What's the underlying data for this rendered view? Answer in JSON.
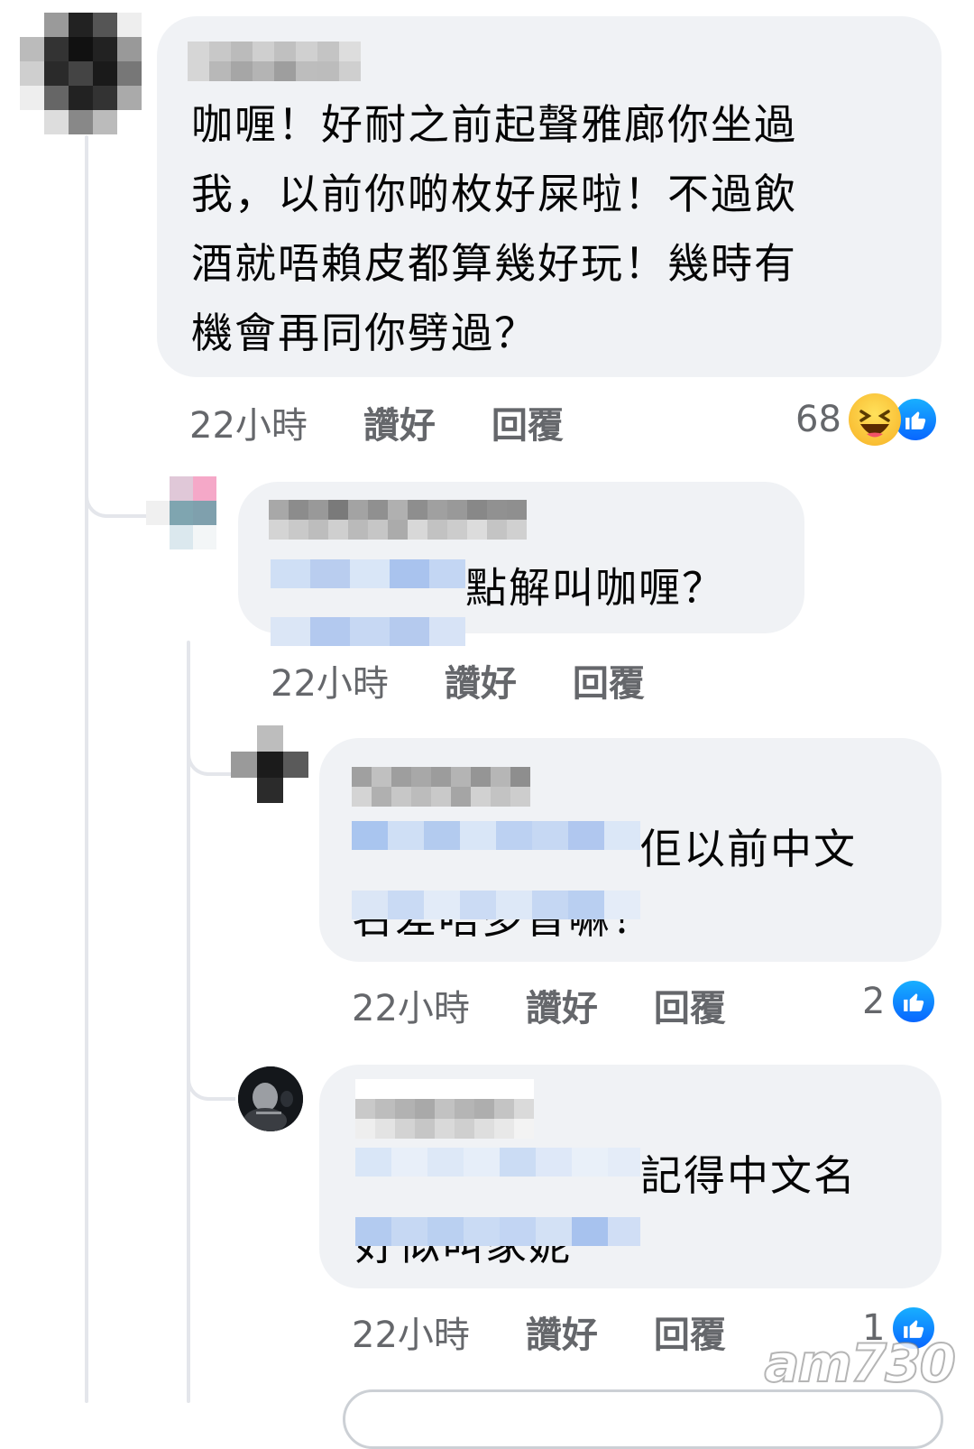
{
  "comments": [
    {
      "text": "咖喱！好耐之前起聲雅廊你坐過我，以前你啲枚好屎啦！不過飲酒就唔賴皮都算幾好玩！幾時有機會再同你劈過？",
      "lines": [
        "咖喱！好耐之前起聲雅廊你坐過",
        "我，以前你啲枚好屎啦！不過飲",
        "酒就唔賴皮都算幾好玩！幾時有",
        "機會再同你劈過？"
      ],
      "time": "22小時",
      "like_label": "讚好",
      "reply_label": "回覆",
      "reaction_count": "68",
      "reactions": [
        "haha-icon",
        "like-icon"
      ]
    },
    {
      "text": "點解叫咖喱？",
      "time": "22小時",
      "like_label": "讚好",
      "reply_label": "回覆"
    },
    {
      "lines": [
        "佢以前中文",
        "名差唔多音嘛！"
      ],
      "time": "22小時",
      "like_label": "讚好",
      "reply_label": "回覆",
      "reaction_count": "2",
      "reactions": [
        "like-icon"
      ]
    },
    {
      "lines": [
        "記得中文名",
        "好似叫家妮"
      ],
      "time": "22小時",
      "like_label": "讚好",
      "reply_label": "回覆",
      "reaction_count": "1",
      "reactions": [
        "like-icon"
      ]
    }
  ],
  "watermark": "am730",
  "colors": {
    "bubble": "#f0f2f5",
    "meta": "#65676b",
    "like_blue": "#0866ff",
    "thread_line": "#e4e6eb"
  }
}
